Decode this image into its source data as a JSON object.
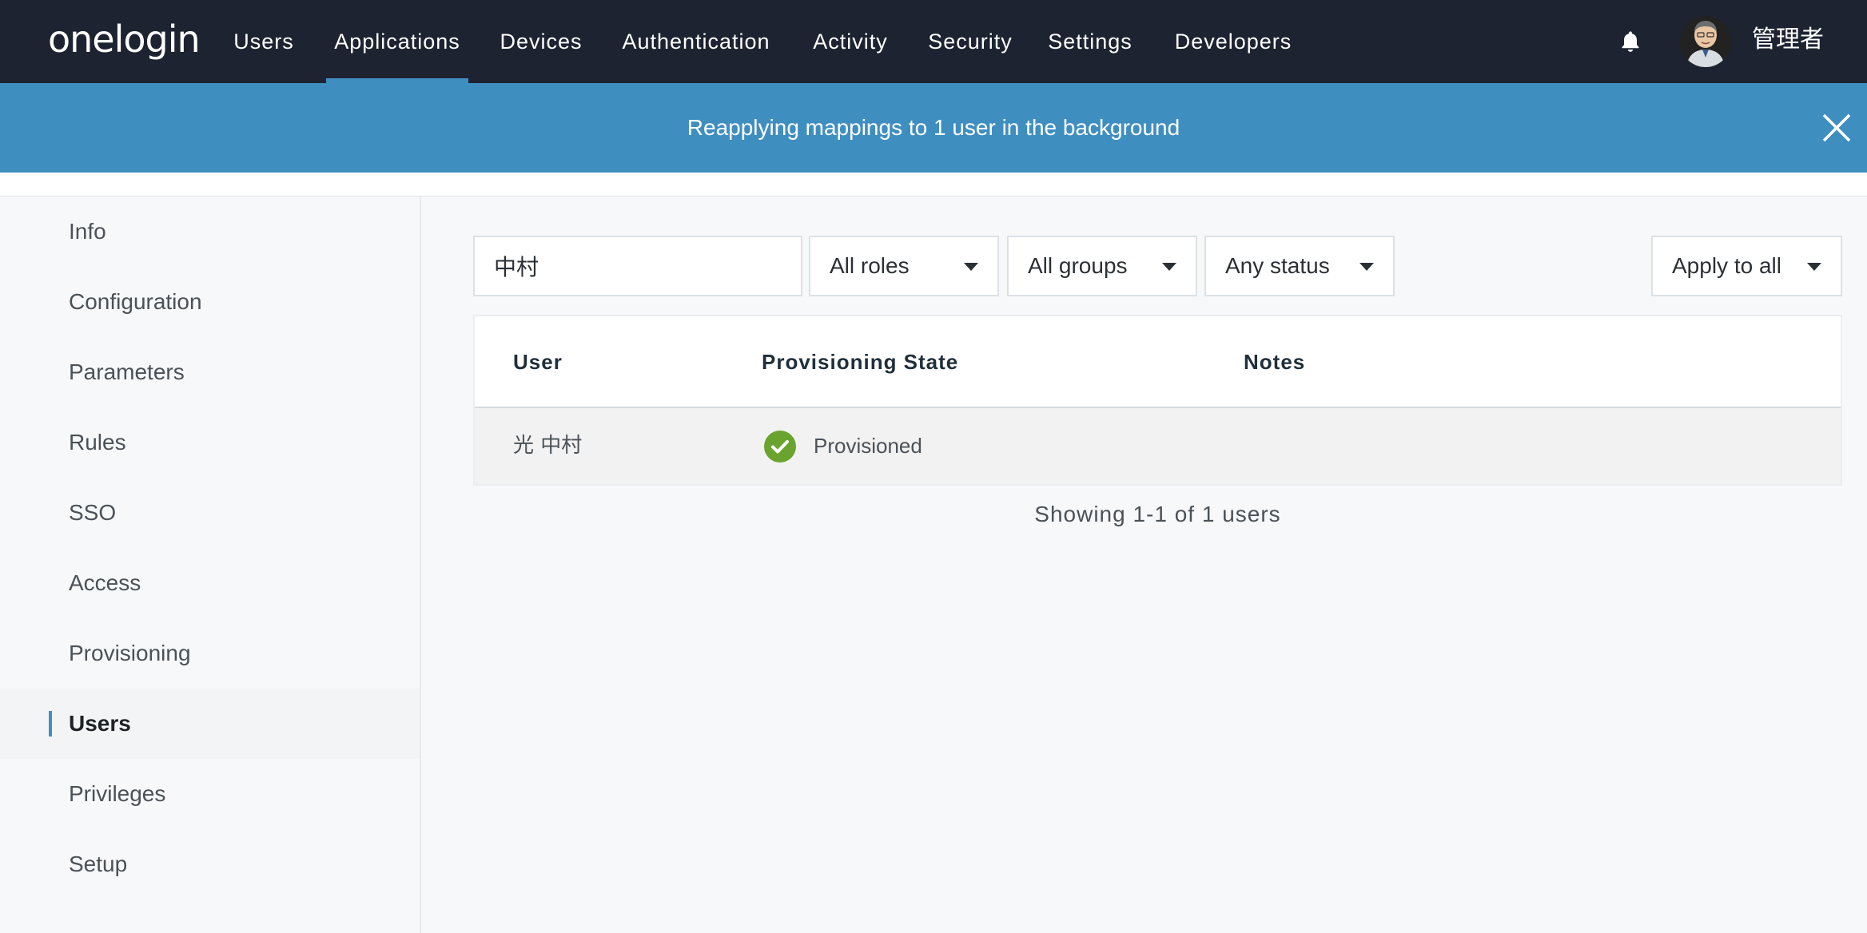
{
  "header": {
    "logo": "onelogin",
    "nav": [
      {
        "label": "Users"
      },
      {
        "label": "Applications",
        "active": true
      },
      {
        "label": "Devices"
      },
      {
        "label": "Authentication"
      },
      {
        "label": "Activity"
      },
      {
        "label": "Security"
      },
      {
        "label": "Settings"
      },
      {
        "label": "Developers"
      }
    ],
    "icons": {
      "notifications": "bell-icon",
      "close": "close-icon"
    },
    "user_name": "管理者"
  },
  "banner": {
    "message": "Reapplying mappings to 1 user in the background"
  },
  "sidebar": {
    "items": [
      {
        "label": "Info"
      },
      {
        "label": "Configuration"
      },
      {
        "label": "Parameters"
      },
      {
        "label": "Rules"
      },
      {
        "label": "SSO"
      },
      {
        "label": "Access"
      },
      {
        "label": "Provisioning"
      },
      {
        "label": "Users",
        "active": true
      },
      {
        "label": "Privileges"
      },
      {
        "label": "Setup"
      }
    ]
  },
  "filters": {
    "search_value": "中村",
    "roles": "All roles",
    "groups": "All groups",
    "status": "Any status",
    "apply": "Apply to all"
  },
  "table": {
    "columns": [
      "User",
      "Provisioning State",
      "Notes"
    ],
    "rows": [
      {
        "user": "光 中村",
        "state": "Provisioned",
        "notes": ""
      }
    ]
  },
  "footer": {
    "showing": "Showing 1-1 of 1 users"
  },
  "colors": {
    "nav_bg": "#1d2330",
    "accent": "#3f8ec0",
    "success": "#6aa42f"
  }
}
